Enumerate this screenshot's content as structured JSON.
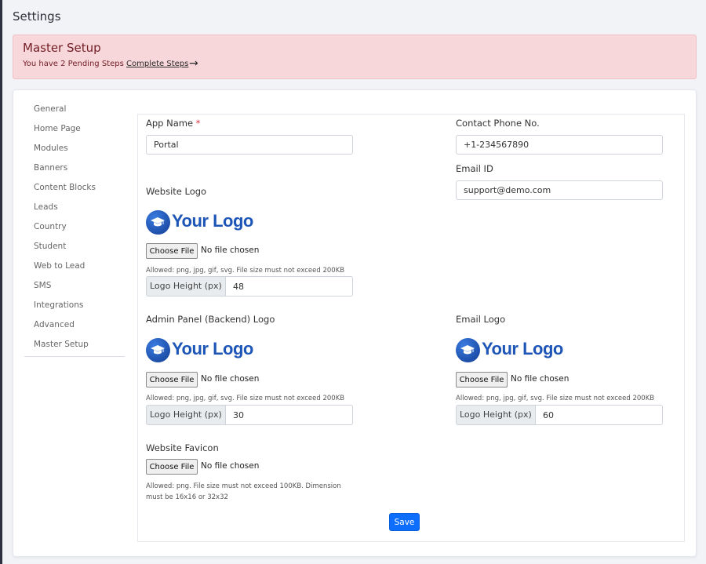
{
  "page": {
    "title": "Settings"
  },
  "alert": {
    "title": "Master Setup",
    "text": "You have 2 Pending Steps",
    "link": "Complete Steps",
    "arrow": "→"
  },
  "nav": {
    "items": [
      {
        "label": "General"
      },
      {
        "label": "Home Page"
      },
      {
        "label": "Modules"
      },
      {
        "label": "Banners"
      },
      {
        "label": "Content Blocks"
      },
      {
        "label": "Leads"
      },
      {
        "label": "Country"
      },
      {
        "label": "Student"
      },
      {
        "label": "Web to Lead"
      },
      {
        "label": "SMS"
      },
      {
        "label": "Integrations"
      },
      {
        "label": "Advanced"
      },
      {
        "label": "Master Setup"
      }
    ]
  },
  "form": {
    "app_name": {
      "label": "App Name",
      "required_mark": "*",
      "value": "Portal"
    },
    "contact_phone": {
      "label": "Contact Phone No.",
      "value": "+1-234567890"
    },
    "email_id": {
      "label": "Email ID",
      "value": "support@demo.com"
    },
    "logo_text": "Your Logo",
    "file_button": "Choose File",
    "file_status": "No file chosen",
    "height_label": "Logo Height (px)",
    "website_logo": {
      "label": "Website Logo",
      "help": "Allowed: png, jpg, gif, svg. File size must not exceed 200KB",
      "height": "48"
    },
    "admin_logo": {
      "label": "Admin Panel (Backend) Logo",
      "help": "Allowed: png, jpg, gif, svg. File size must not exceed 200KB",
      "height": "30"
    },
    "email_logo": {
      "label": "Email Logo",
      "help": "Allowed: png, jpg, gif, svg. File size must not exceed 200KB",
      "height": "60"
    },
    "favicon": {
      "label": "Website Favicon",
      "help_line1": "Allowed: png. File size must not exceed 100KB. Dimension",
      "help_line2": "must be 16x16 or 32x32"
    },
    "save_label": "Save"
  },
  "colors": {
    "primary": "#0d6efd",
    "alert_bg": "#f7d7da",
    "alert_text": "#721c24",
    "logo_blue": "#1e56b8"
  }
}
